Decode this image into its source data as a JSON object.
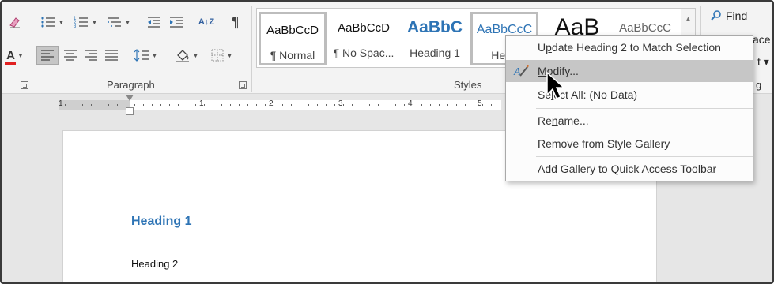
{
  "ribbon": {
    "paragraph_group_label": "Paragraph",
    "styles_group_label": "Styles",
    "pilcrow": "¶",
    "sort_label": "A↓Z",
    "find_label": "Find",
    "replace_fragment": "ace",
    "select_fragment": "t ▾",
    "editing_fragment": "g"
  },
  "gallery": {
    "tiles": [
      {
        "sample": "AaBbCcD",
        "name": "¶ Normal"
      },
      {
        "sample": "AaBbCcD",
        "name": "¶ No Spac..."
      },
      {
        "sample": "AaBbC",
        "name": "Heading 1"
      },
      {
        "sample": "AaBbCcC",
        "name": "Head"
      },
      {
        "sample": "AaB",
        "name": ""
      },
      {
        "sample": "AaBbCcC",
        "name": ""
      }
    ]
  },
  "ruler": {
    "numbers": [
      "1",
      "1",
      "2",
      "3",
      "4",
      "5"
    ]
  },
  "document": {
    "heading1": "Heading 1",
    "heading2": "Heading 2"
  },
  "menu": {
    "items": [
      {
        "pre": "U",
        "u": "p",
        "post": "date Heading 2 to Match Selection"
      },
      {
        "pre": "",
        "u": "M",
        "post": "odify..."
      },
      {
        "pre": "Se",
        "u": "l",
        "post": "ect All: (No Data)"
      },
      {
        "pre": "Re",
        "u": "n",
        "post": "ame..."
      },
      {
        "pre": "Remove from Style Gallery",
        "u": "",
        "post": ""
      },
      {
        "pre": "",
        "u": "A",
        "post": "dd Gallery to Quick Access Toolbar"
      }
    ]
  },
  "colors": {
    "heading_blue": "#2e74b5",
    "highlight": "#c6c6c6",
    "font_red": "#e02020"
  }
}
